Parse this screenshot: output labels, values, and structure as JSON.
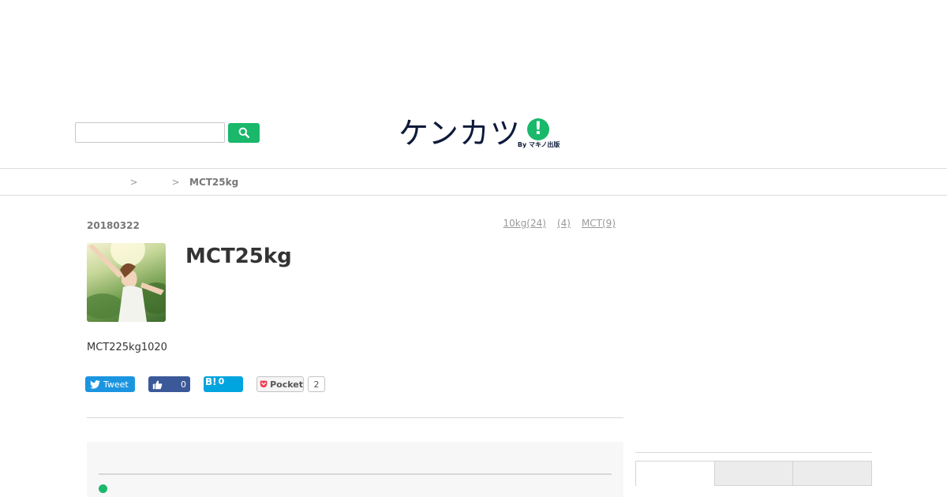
{
  "search": {
    "placeholder": ""
  },
  "logo": {
    "text": "ケンカツ",
    "mark": "!",
    "byline": "By マキノ出版"
  },
  "breadcrumb": {
    "home": "",
    "category": "",
    "separator": ">",
    "current": "MCT25kg"
  },
  "article": {
    "date": "20180322",
    "tags": [
      "10kg(24)",
      "(4)",
      "MCT(9)"
    ],
    "title": "MCT25kg",
    "lead": "MCT225kg1020"
  },
  "social": {
    "tweet_label": "Tweet",
    "facebook_count": "0",
    "hatena_label": "B!",
    "hatena_count": "0",
    "pocket_label": "Pocket",
    "pocket_count": "2"
  },
  "sidebar": {
    "tabs": [
      "",
      "",
      ""
    ]
  },
  "colors": {
    "accent": "#19b86a",
    "navy": "#0d1a3a",
    "twitter": "#1b95e0",
    "facebook": "#3b5998",
    "hatena": "#00a4de"
  }
}
